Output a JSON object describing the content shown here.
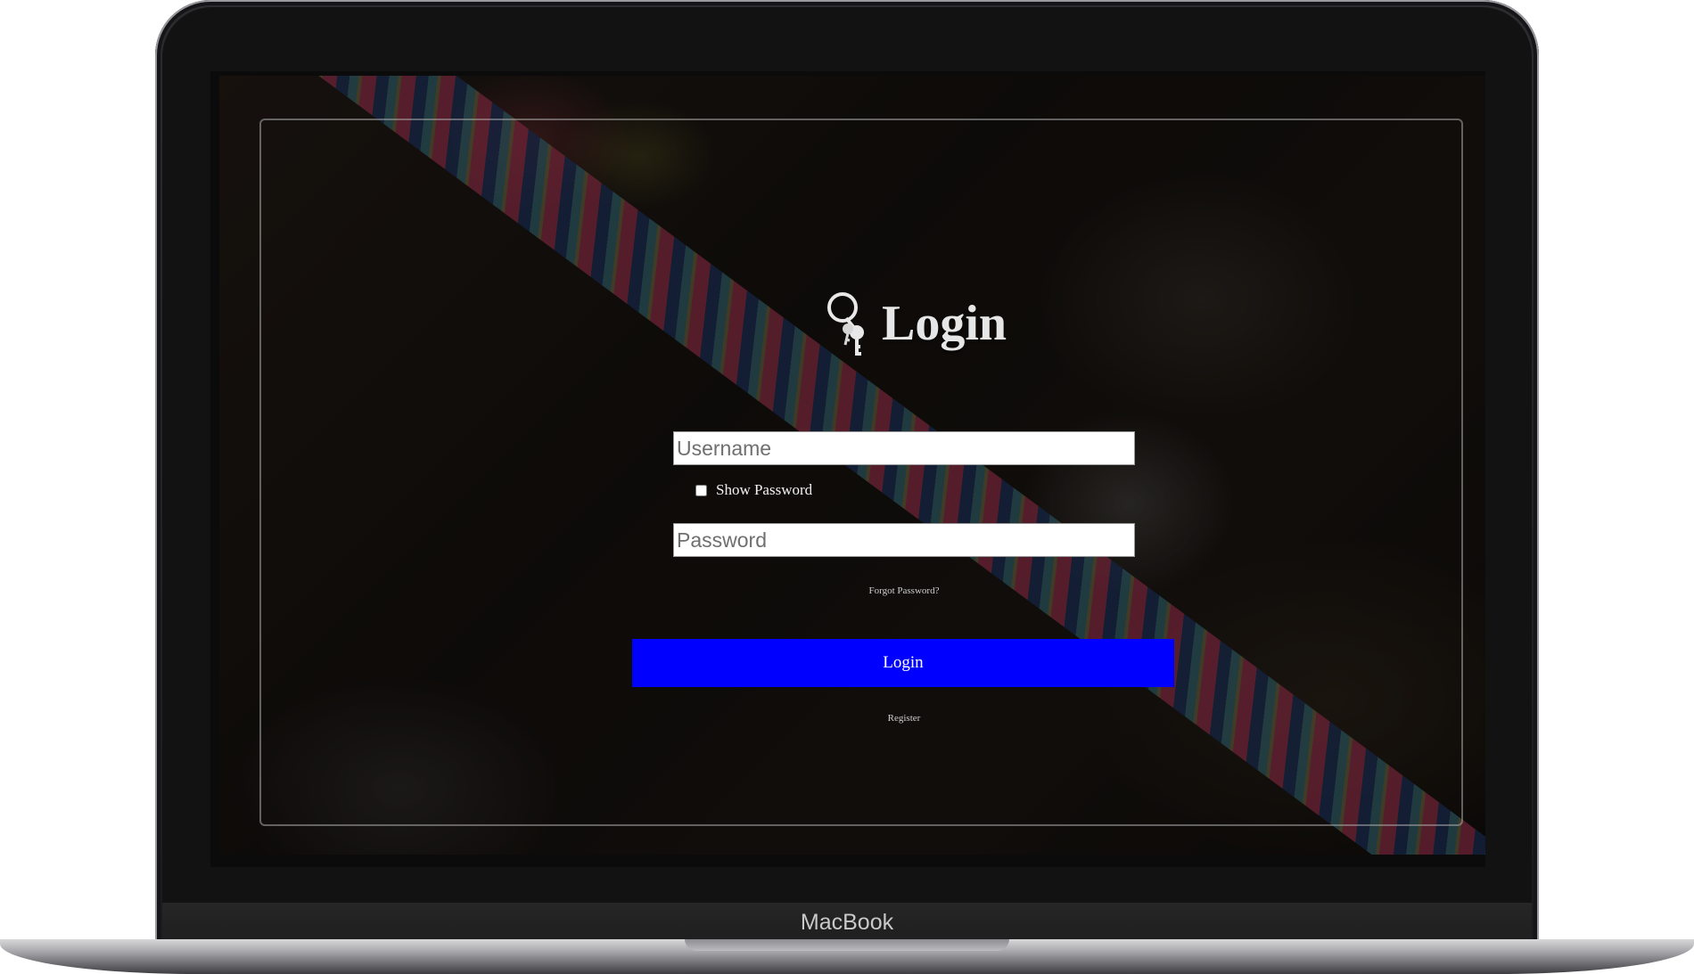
{
  "device": {
    "brand_label": "MacBook"
  },
  "login_page": {
    "title": "Login",
    "icon": "keys-icon",
    "username_placeholder": "Username",
    "show_password_label": "Show Password",
    "show_password_checked": false,
    "password_placeholder": "Password",
    "forgot_password_label": "Forgot Password?",
    "login_button_label": "Login",
    "register_label": "Register"
  },
  "colors": {
    "login_button": "#0000ff",
    "title_text": "#e6e6e6",
    "frame_border": "#aaaaaa"
  }
}
